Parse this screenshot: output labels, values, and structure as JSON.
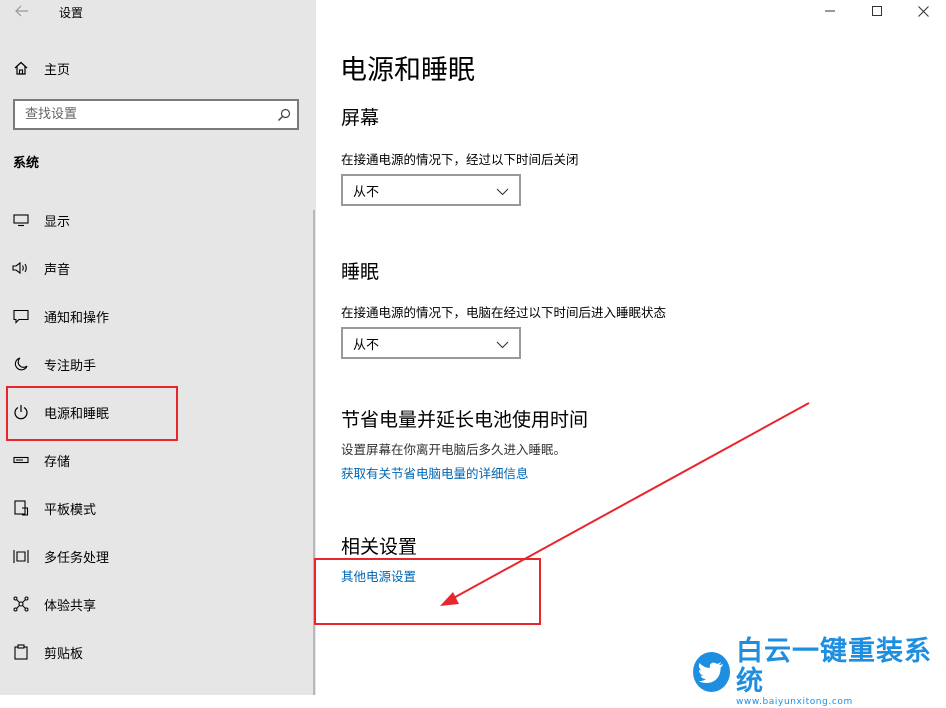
{
  "window": {
    "app_title": "设置",
    "controls": {
      "minimize_icon": "minimize-icon",
      "maximize_icon": "maximize-icon",
      "close_icon": "close-icon"
    }
  },
  "sidebar": {
    "back_icon": "back-arrow-icon",
    "home_label": "主页",
    "search_placeholder": "查找设置",
    "section_title": "系统",
    "items": [
      {
        "label": "显示",
        "icon": "display-icon"
      },
      {
        "label": "声音",
        "icon": "speaker-icon"
      },
      {
        "label": "通知和操作",
        "icon": "notification-icon"
      },
      {
        "label": "专注助手",
        "icon": "moon-icon"
      },
      {
        "label": "电源和睡眠",
        "icon": "power-icon",
        "selected": true
      },
      {
        "label": "存储",
        "icon": "storage-icon"
      },
      {
        "label": "平板模式",
        "icon": "tablet-icon"
      },
      {
        "label": "多任务处理",
        "icon": "multitask-icon"
      },
      {
        "label": "体验共享",
        "icon": "share-icon"
      },
      {
        "label": "剪贴板",
        "icon": "clipboard-icon"
      }
    ]
  },
  "main": {
    "title": "电源和睡眠",
    "screen": {
      "heading": "屏幕",
      "description": "在接通电源的情况下，经过以下时间后关闭",
      "dropdown_value": "从不"
    },
    "sleep": {
      "heading": "睡眠",
      "description": "在接通电源的情况下，电脑在经过以下时间后进入睡眠状态",
      "dropdown_value": "从不"
    },
    "battery": {
      "heading": "节省电量并延长电池使用时间",
      "description": "设置屏幕在你离开电脑后多久进入睡眠。",
      "link": "获取有关节省电脑电量的详细信息"
    },
    "related": {
      "heading": "相关设置",
      "link": "其他电源设置"
    }
  },
  "watermark": {
    "text": "白云一键重装系统",
    "url_text": "www.baiyunxitong.com",
    "color": "#1e8fe0"
  },
  "annotations": {
    "color": "#e8262c"
  }
}
